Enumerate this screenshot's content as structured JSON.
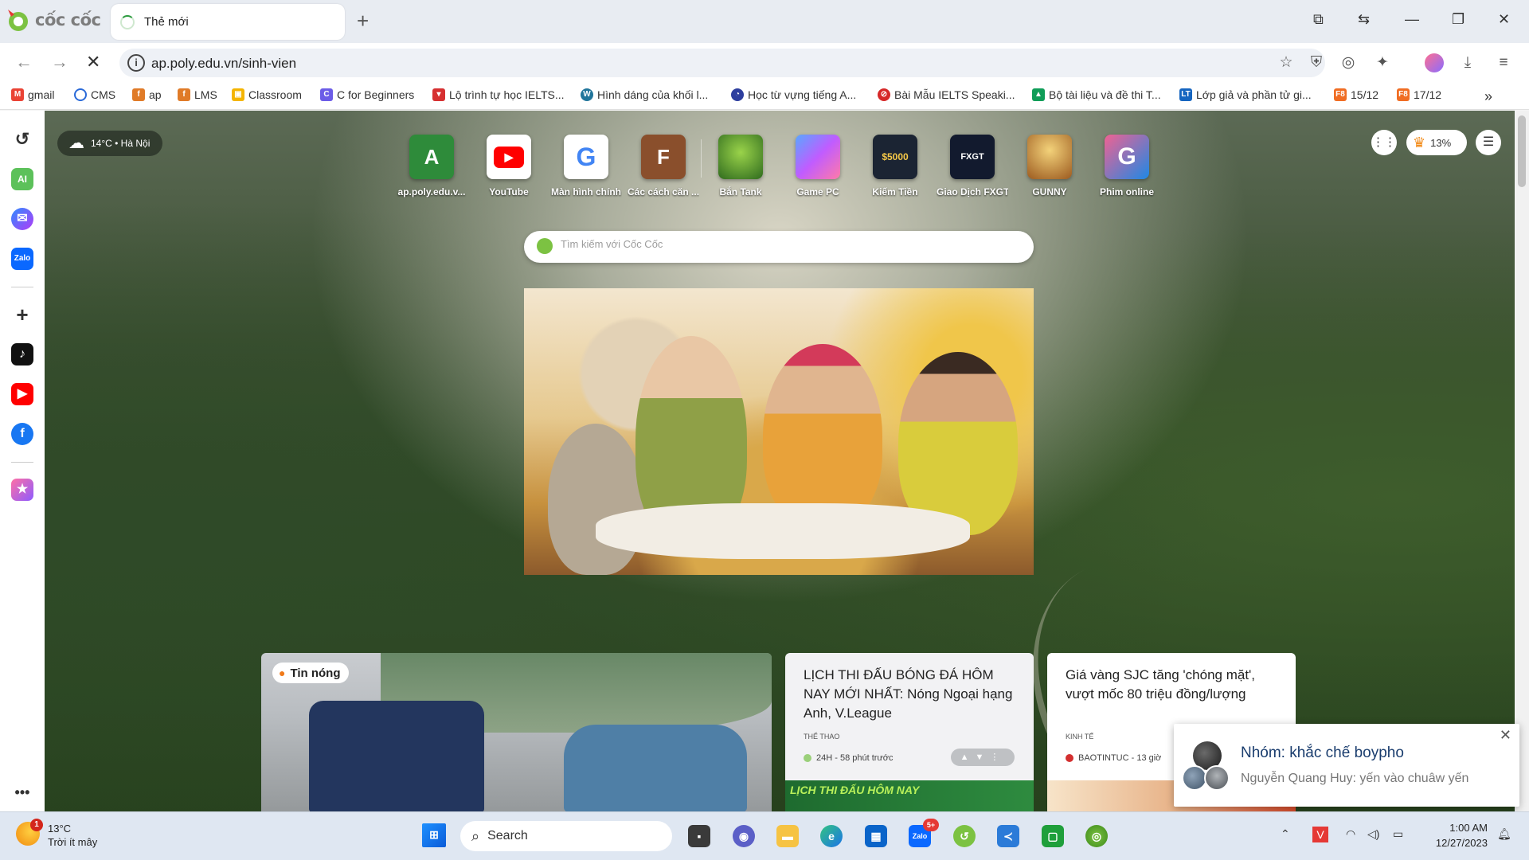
{
  "browser": {
    "brand": "cốc cốc",
    "tab_title": "Thẻ mới",
    "url": "ap.poly.edu.vn/sinh-vien"
  },
  "bookmarks": [
    {
      "label": "gmail",
      "color": "#ea4335"
    },
    {
      "label": "CMS",
      "color": "#2a6ad8"
    },
    {
      "label": "ap",
      "color": "#e07b28"
    },
    {
      "label": "LMS",
      "color": "#e07b28"
    },
    {
      "label": "Classroom",
      "color": "#f4b400"
    },
    {
      "label": "C for Beginners",
      "color": "#6c5ce7"
    },
    {
      "label": "Lộ trình tự học IELTS...",
      "color": "#d63031"
    },
    {
      "label": "Hình dáng của khối l...",
      "color": "#21759b"
    },
    {
      "label": "Học từ vựng tiếng A...",
      "color": "#2d3e9e"
    },
    {
      "label": "Bài Mẫu IELTS Speaki...",
      "color": "#d62828"
    },
    {
      "label": "Bộ tài liệu và đề thi T...",
      "color": "#0f9d58"
    },
    {
      "label": "Lớp giả và phần tử gi...",
      "color": "#1565c0"
    },
    {
      "label": "15/12",
      "color": "#f06d23"
    },
    {
      "label": "17/12",
      "color": "#f06d23"
    }
  ],
  "weather_chip": "14°C • Hà Nội",
  "speed_dials": [
    {
      "label": "ap.poly.edu.v...",
      "glyph": "A",
      "color": "#2e8b3a"
    },
    {
      "label": "YouTube",
      "glyph": "▶",
      "color": "#ff0000"
    },
    {
      "label": "Màn hình chính",
      "glyph": "G",
      "color": "#ffffff"
    },
    {
      "label": "Các cách căn ...",
      "glyph": "F",
      "color": "#8a4f2c"
    },
    {
      "label": "Bắn Tank",
      "glyph": "",
      "color": "#4e8a2f"
    },
    {
      "label": "Game PC",
      "glyph": "",
      "color": "#7b5ec9"
    },
    {
      "label": "Kiếm Tiền",
      "glyph": "$5000",
      "color": "#1b2433"
    },
    {
      "label": "Giao Dịch FXGT",
      "glyph": "FXGT",
      "color": "#121a2e"
    },
    {
      "label": "GUNNY",
      "glyph": "",
      "color": "#c78a2a"
    },
    {
      "label": "Phim online",
      "glyph": "G",
      "color": "#1e88e5"
    }
  ],
  "search": {
    "placeholder": "Tìm kiếm với Cốc Cốc"
  },
  "level_percent": "13%",
  "news": {
    "hot_badge": "Tin nóng",
    "card1": {
      "title": "LỊCH THI ĐẤU BÓNG ĐÁ HÔM NAY MỚI NHẤT: Nóng Ngoại hạng Anh, V.League",
      "category": "THỂ THAO",
      "source": "24H - 58 phút trước",
      "thumb_text": "LỊCH THI ĐẤU HÔM NAY"
    },
    "card2": {
      "title": "Giá vàng SJC tăng 'chóng mặt', vượt mốc 80 triệu đồng/lượng",
      "category": "KINH TẾ",
      "source": "BAOTINTUC - 13 giờ"
    }
  },
  "notification": {
    "title": "Nhóm: khắc chế boypho",
    "body": "Nguyễn Quang Huy: yến vào chuâw yến"
  },
  "taskbar": {
    "weather_temp": "13°C",
    "weather_desc": "Trời ít mây",
    "weather_badge": "1",
    "search_label": "Search",
    "zalo_badge": "5+",
    "time": "1:00 AM",
    "date": "12/27/2023"
  }
}
